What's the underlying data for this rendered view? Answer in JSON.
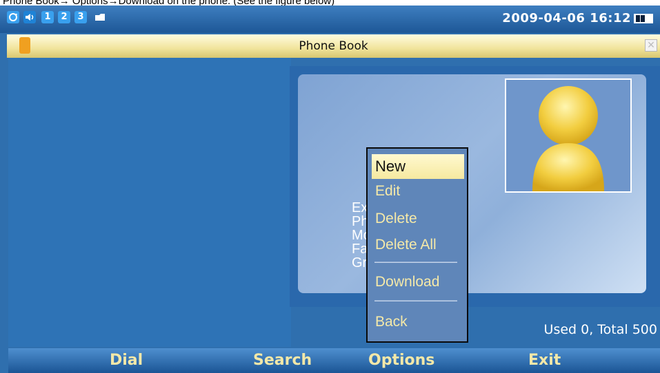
{
  "caption": "Phone Book→ Options→Download on the phone. (See the figure below)",
  "statusbar": {
    "icons": [
      "refresh-icon",
      "volume-icon"
    ],
    "lines": [
      "1",
      "2",
      "3"
    ],
    "datetime": "2009-04-06 16:12"
  },
  "titlebar": {
    "title": "Phone Book"
  },
  "contact_fields": [
    "Ex",
    "Ph",
    "Mo",
    "Fa",
    "Gr"
  ],
  "menu": {
    "items": [
      {
        "label": "New",
        "selected": true
      },
      {
        "label": "Edit"
      },
      {
        "label": "Delete"
      },
      {
        "label": "Delete All"
      },
      {
        "label": "Download"
      },
      {
        "label": "Back"
      }
    ]
  },
  "usage": "Used 0, Total 500",
  "softkeys": [
    "Dial",
    "Search",
    "Options",
    "Exit"
  ],
  "colors": {
    "screen_bg": "#2f6fae",
    "title_bar": "#f1e49c",
    "menu_selected": "#f6e9a0",
    "menu_text": "#f5e9a8"
  }
}
